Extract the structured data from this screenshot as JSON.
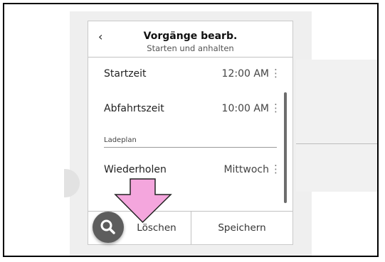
{
  "header": {
    "back_glyph": "‹",
    "title": "Vorgänge bearb.",
    "subtitle": "Starten und anhalten"
  },
  "rows": [
    {
      "label": "Startzeit",
      "value": "12:00 AM"
    },
    {
      "label": "Abfahrtszeit",
      "value": "10:00 AM"
    },
    {
      "label": "Wiederholen",
      "value": "Mittwoch"
    }
  ],
  "section": {
    "label": "Ladeplan"
  },
  "footer": {
    "delete_label": "Löschen",
    "save_label": "Speichern"
  },
  "icons": {
    "more": "more-vert-icon",
    "search": "search-icon",
    "arrow": "down-arrow-icon"
  },
  "colors": {
    "arrow_fill": "#f4a6dd",
    "arrow_stroke": "#222222",
    "fab": "#5d5d5d",
    "scrollbar": "#6d6d6d"
  }
}
